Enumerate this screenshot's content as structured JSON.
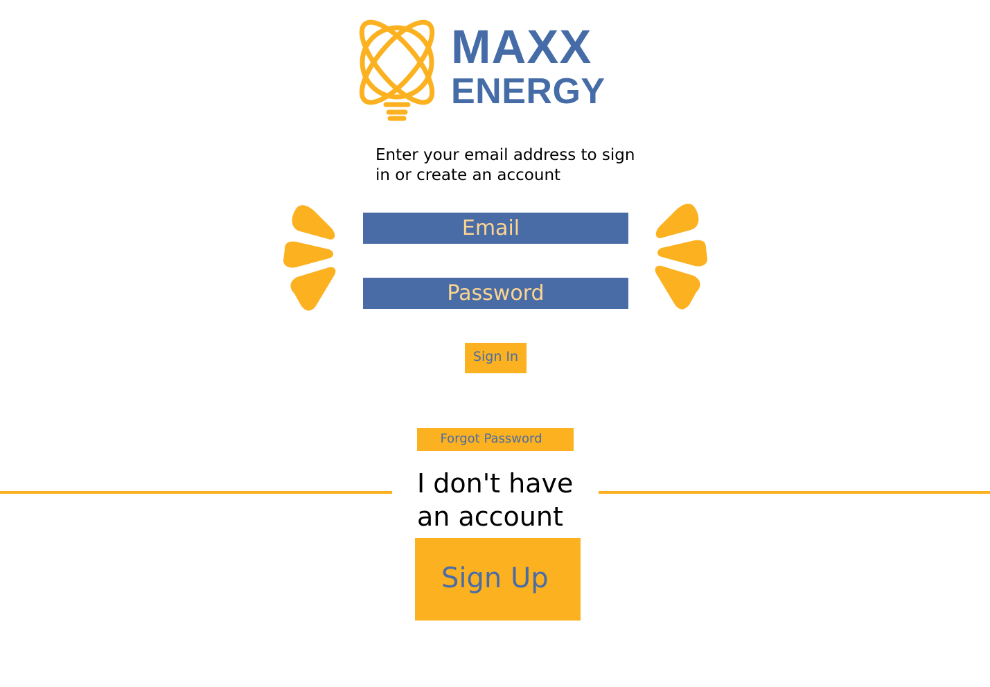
{
  "brand": {
    "line1": "MAXX",
    "line2": "ENERGY",
    "logo_icon": "lightbulb-atom-icon"
  },
  "login": {
    "instructions": "Enter your email address to sign in or create an account",
    "email_placeholder": "Email",
    "password_placeholder": "Password",
    "sign_in_label": "Sign In",
    "forgot_password_label": "Forgot Password"
  },
  "signup": {
    "prompt": "I don't have an account",
    "sign_up_label": "Sign Up"
  },
  "colors": {
    "brand_blue": "#466ca7",
    "field_blue": "#4a6ca6",
    "accent_yellow": "#fbb120",
    "placeholder_text": "#fcd691"
  }
}
